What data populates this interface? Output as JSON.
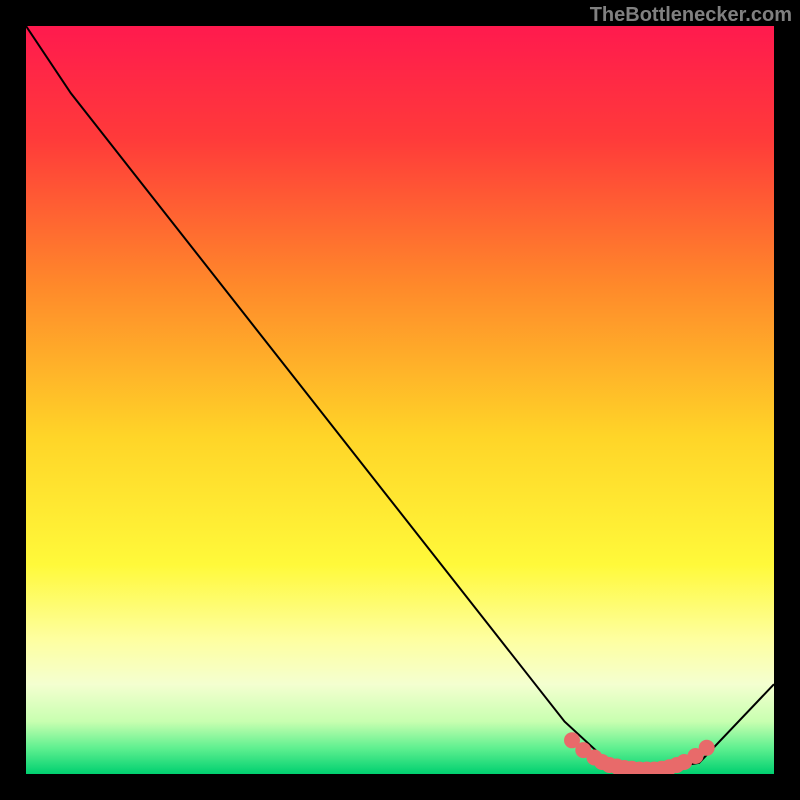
{
  "watermark": "TheBottlenecker.com",
  "chart_data": {
    "type": "line",
    "title": "",
    "xlabel": "",
    "ylabel": "",
    "xlim": [
      0,
      100
    ],
    "ylim": [
      0,
      100
    ],
    "grid": false,
    "series": [
      {
        "name": "curve",
        "color": "#000000",
        "points": [
          {
            "x": 0,
            "y": 100
          },
          {
            "x": 6,
            "y": 91
          },
          {
            "x": 72,
            "y": 7
          },
          {
            "x": 78,
            "y": 1.5
          },
          {
            "x": 84,
            "y": 0.5
          },
          {
            "x": 90,
            "y": 1.5
          },
          {
            "x": 100,
            "y": 12
          }
        ]
      }
    ],
    "markers": {
      "x": [
        73,
        74.5,
        76,
        77,
        78,
        79,
        80,
        81,
        82,
        83,
        84,
        85,
        86,
        87,
        88,
        89.5,
        91
      ],
      "y": [
        4.5,
        3.2,
        2.2,
        1.6,
        1.2,
        1.0,
        0.8,
        0.7,
        0.6,
        0.6,
        0.6,
        0.7,
        0.9,
        1.2,
        1.6,
        2.4,
        3.5
      ],
      "color": "#e86a6a",
      "size": 8
    },
    "gradient_stops": [
      {
        "offset": 0.0,
        "color": "#ff1a4e"
      },
      {
        "offset": 0.15,
        "color": "#ff3a3a"
      },
      {
        "offset": 0.35,
        "color": "#ff8a2a"
      },
      {
        "offset": 0.55,
        "color": "#ffd528"
      },
      {
        "offset": 0.72,
        "color": "#fff93a"
      },
      {
        "offset": 0.82,
        "color": "#feffa0"
      },
      {
        "offset": 0.88,
        "color": "#f4ffd0"
      },
      {
        "offset": 0.93,
        "color": "#c8ffb0"
      },
      {
        "offset": 0.965,
        "color": "#60f090"
      },
      {
        "offset": 1.0,
        "color": "#00d070"
      }
    ]
  }
}
